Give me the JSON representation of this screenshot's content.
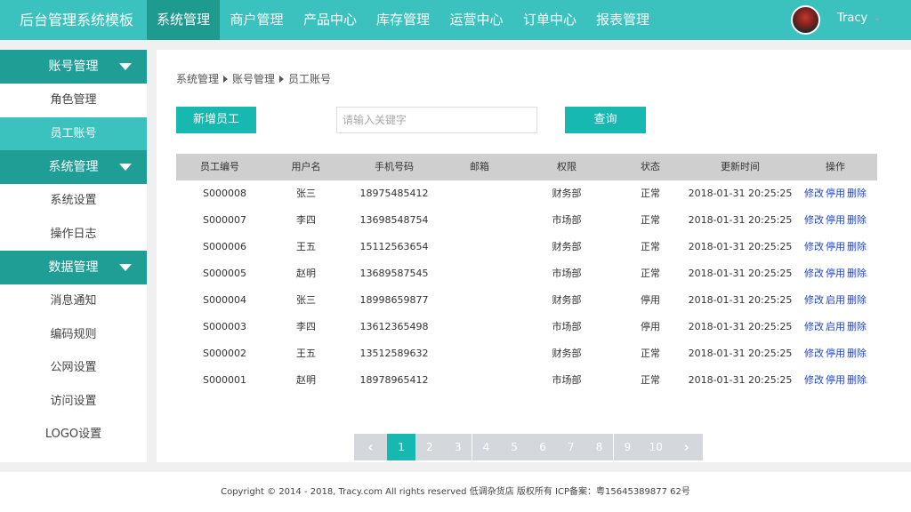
{
  "brand": "后台管理系统模板",
  "nav": [
    "系统管理",
    "商户管理",
    "产品中心",
    "库存管理",
    "运营中心",
    "订单中心",
    "报表管理"
  ],
  "user": {
    "name": "Tracy"
  },
  "sidebar": {
    "groups": [
      {
        "label": "账号管理",
        "items": [
          "角色管理",
          "员工账号"
        ]
      },
      {
        "label": "系统管理",
        "items": [
          "系统设置",
          "操作日志"
        ]
      },
      {
        "label": "数据管理",
        "items": [
          "消息通知",
          "编码规则",
          "公网设置",
          "访问设置",
          "LOGO设置"
        ]
      }
    ]
  },
  "breadcrumb": [
    "系统管理",
    "账号管理",
    "员工账号"
  ],
  "toolbar": {
    "add_label": "新增员工",
    "search_placeholder": "请输入关键字",
    "query_label": "查询"
  },
  "table": {
    "headers": [
      "员工编号",
      "用户名",
      "手机号码",
      "邮箱",
      "权限",
      "状态",
      "更新时间",
      "操作"
    ],
    "rows": [
      [
        "S000008",
        "张三",
        "18975485412",
        "",
        "财务部",
        "正常",
        "2018-01-31 20:25:25",
        "修改",
        "停用",
        "删除"
      ],
      [
        "S000007",
        "李四",
        "13698548754",
        "",
        "市场部",
        "正常",
        "2018-01-31 20:25:25",
        "修改",
        "停用",
        "删除"
      ],
      [
        "S000006",
        "王五",
        "15112563654",
        "",
        "财务部",
        "正常",
        "2018-01-31 20:25:25",
        "修改",
        "停用",
        "删除"
      ],
      [
        "S000005",
        "赵明",
        "13689587545",
        "",
        "市场部",
        "正常",
        "2018-01-31 20:25:25",
        "修改",
        "停用",
        "删除"
      ],
      [
        "S000004",
        "张三",
        "18998659877",
        "",
        "财务部",
        "停用",
        "2018-01-31 20:25:25",
        "修改",
        "启用",
        "删除"
      ],
      [
        "S000003",
        "李四",
        "13612365498",
        "",
        "市场部",
        "停用",
        "2018-01-31 20:25:25",
        "修改",
        "启用",
        "删除"
      ],
      [
        "S000002",
        "王五",
        "13512589632",
        "",
        "财务部",
        "正常",
        "2018-01-31 20:25:25",
        "修改",
        "停用",
        "删除"
      ],
      [
        "S000001",
        "赵明",
        "18978965412",
        "",
        "市场部",
        "正常",
        "2018-01-31 20:25:25",
        "修改",
        "停用",
        "删除"
      ]
    ]
  },
  "pagination": {
    "prev": "‹",
    "next": "›",
    "pages": [
      "1",
      "2",
      "3",
      "4",
      "5",
      "6",
      "7",
      "8",
      "9",
      "10"
    ]
  },
  "footer": "Copyright © 2014 - 2018, Tracy.com All rights reserved 低调杂货店 版权所有 ICP备案：粤15645389877 62号"
}
